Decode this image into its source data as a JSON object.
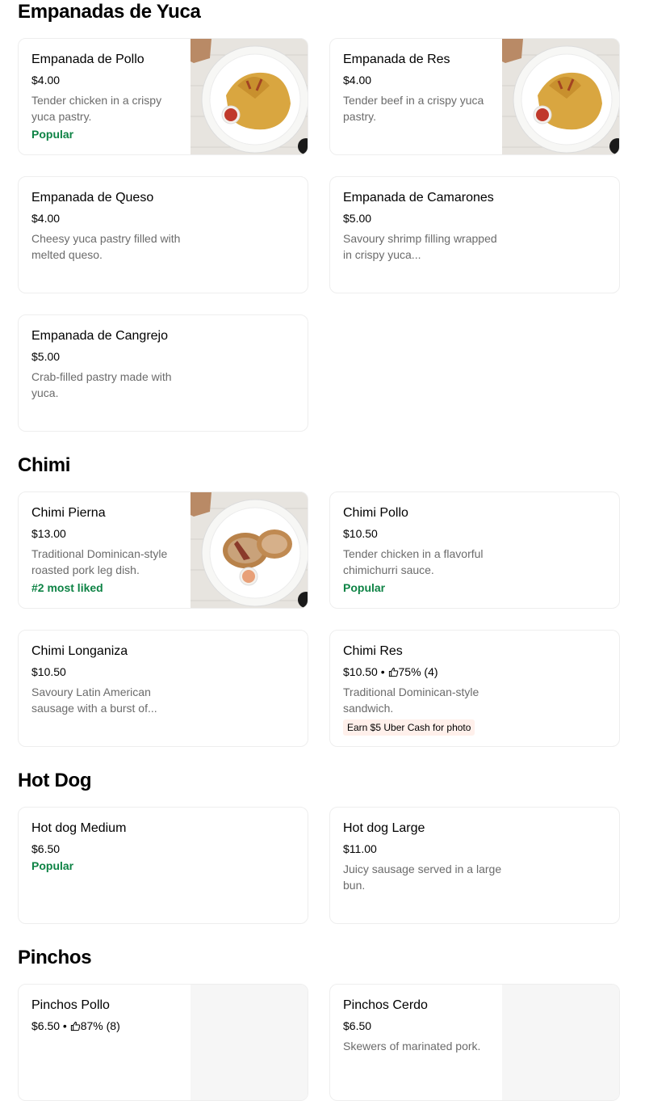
{
  "sections": [
    {
      "title": "Empanadas de Yuca",
      "items": [
        {
          "name": "Empanada de Pollo",
          "price": "$4.00",
          "desc": "Tender chicken in a crispy yuca pastry.",
          "tag": "Popular",
          "image": "empanada-plate"
        },
        {
          "name": "Empanada de Res",
          "price": "$4.00",
          "desc": "Tender beef in a crispy yuca pastry.",
          "image": "empanada-plate"
        },
        {
          "name": "Empanada de Queso",
          "price": "$4.00",
          "desc": "Cheesy yuca pastry filled with melted queso."
        },
        {
          "name": "Empanada de Camarones",
          "price": "$5.00",
          "desc": "Savoury shrimp filling wrapped in crispy yuca..."
        },
        {
          "name": "Empanada de Cangrejo",
          "price": "$5.00",
          "desc": "Crab-filled pastry made with yuca."
        }
      ]
    },
    {
      "title": "Chimi",
      "items": [
        {
          "name": "Chimi Pierna",
          "price": "$13.00",
          "desc": "Traditional Dominican-style roasted pork leg dish.",
          "tag": "#2 most liked",
          "image": "sandwich-plate"
        },
        {
          "name": "Chimi Pollo",
          "price": "$10.50",
          "desc": "Tender chicken in a flavorful chimichurri sauce.",
          "tag": "Popular"
        },
        {
          "name": "Chimi Longaniza",
          "price": "$10.50",
          "desc": "Savoury Latin American sausage with a burst of..."
        },
        {
          "name": "Chimi Res",
          "price": "$10.50",
          "rating": "75% (4)",
          "desc": "Traditional Dominican-style sandwich.",
          "promo": "Earn $5 Uber Cash for photo"
        }
      ]
    },
    {
      "title": "Hot Dog",
      "items": [
        {
          "name": "Hot dog Medium",
          "price": "$6.50",
          "tag": "Popular"
        },
        {
          "name": "Hot dog Large",
          "price": "$11.00",
          "desc": "Juicy sausage served in a large bun."
        }
      ]
    },
    {
      "title": "Pinchos",
      "items": [
        {
          "name": "Pinchos Pollo",
          "price": "$6.50",
          "rating": "87% (8)",
          "image": "placeholder"
        },
        {
          "name": "Pinchos Cerdo",
          "price": "$6.50",
          "desc": "Skewers of marinated pork.",
          "image": "placeholder"
        }
      ]
    }
  ],
  "icons": {
    "rating": "thumbs-up-icon",
    "image_badge": "add-item-icon"
  },
  "colors": {
    "tag_green": "#0e8345",
    "promo_bg": "#fff0eb",
    "desc_gray": "#6b6b6b"
  }
}
